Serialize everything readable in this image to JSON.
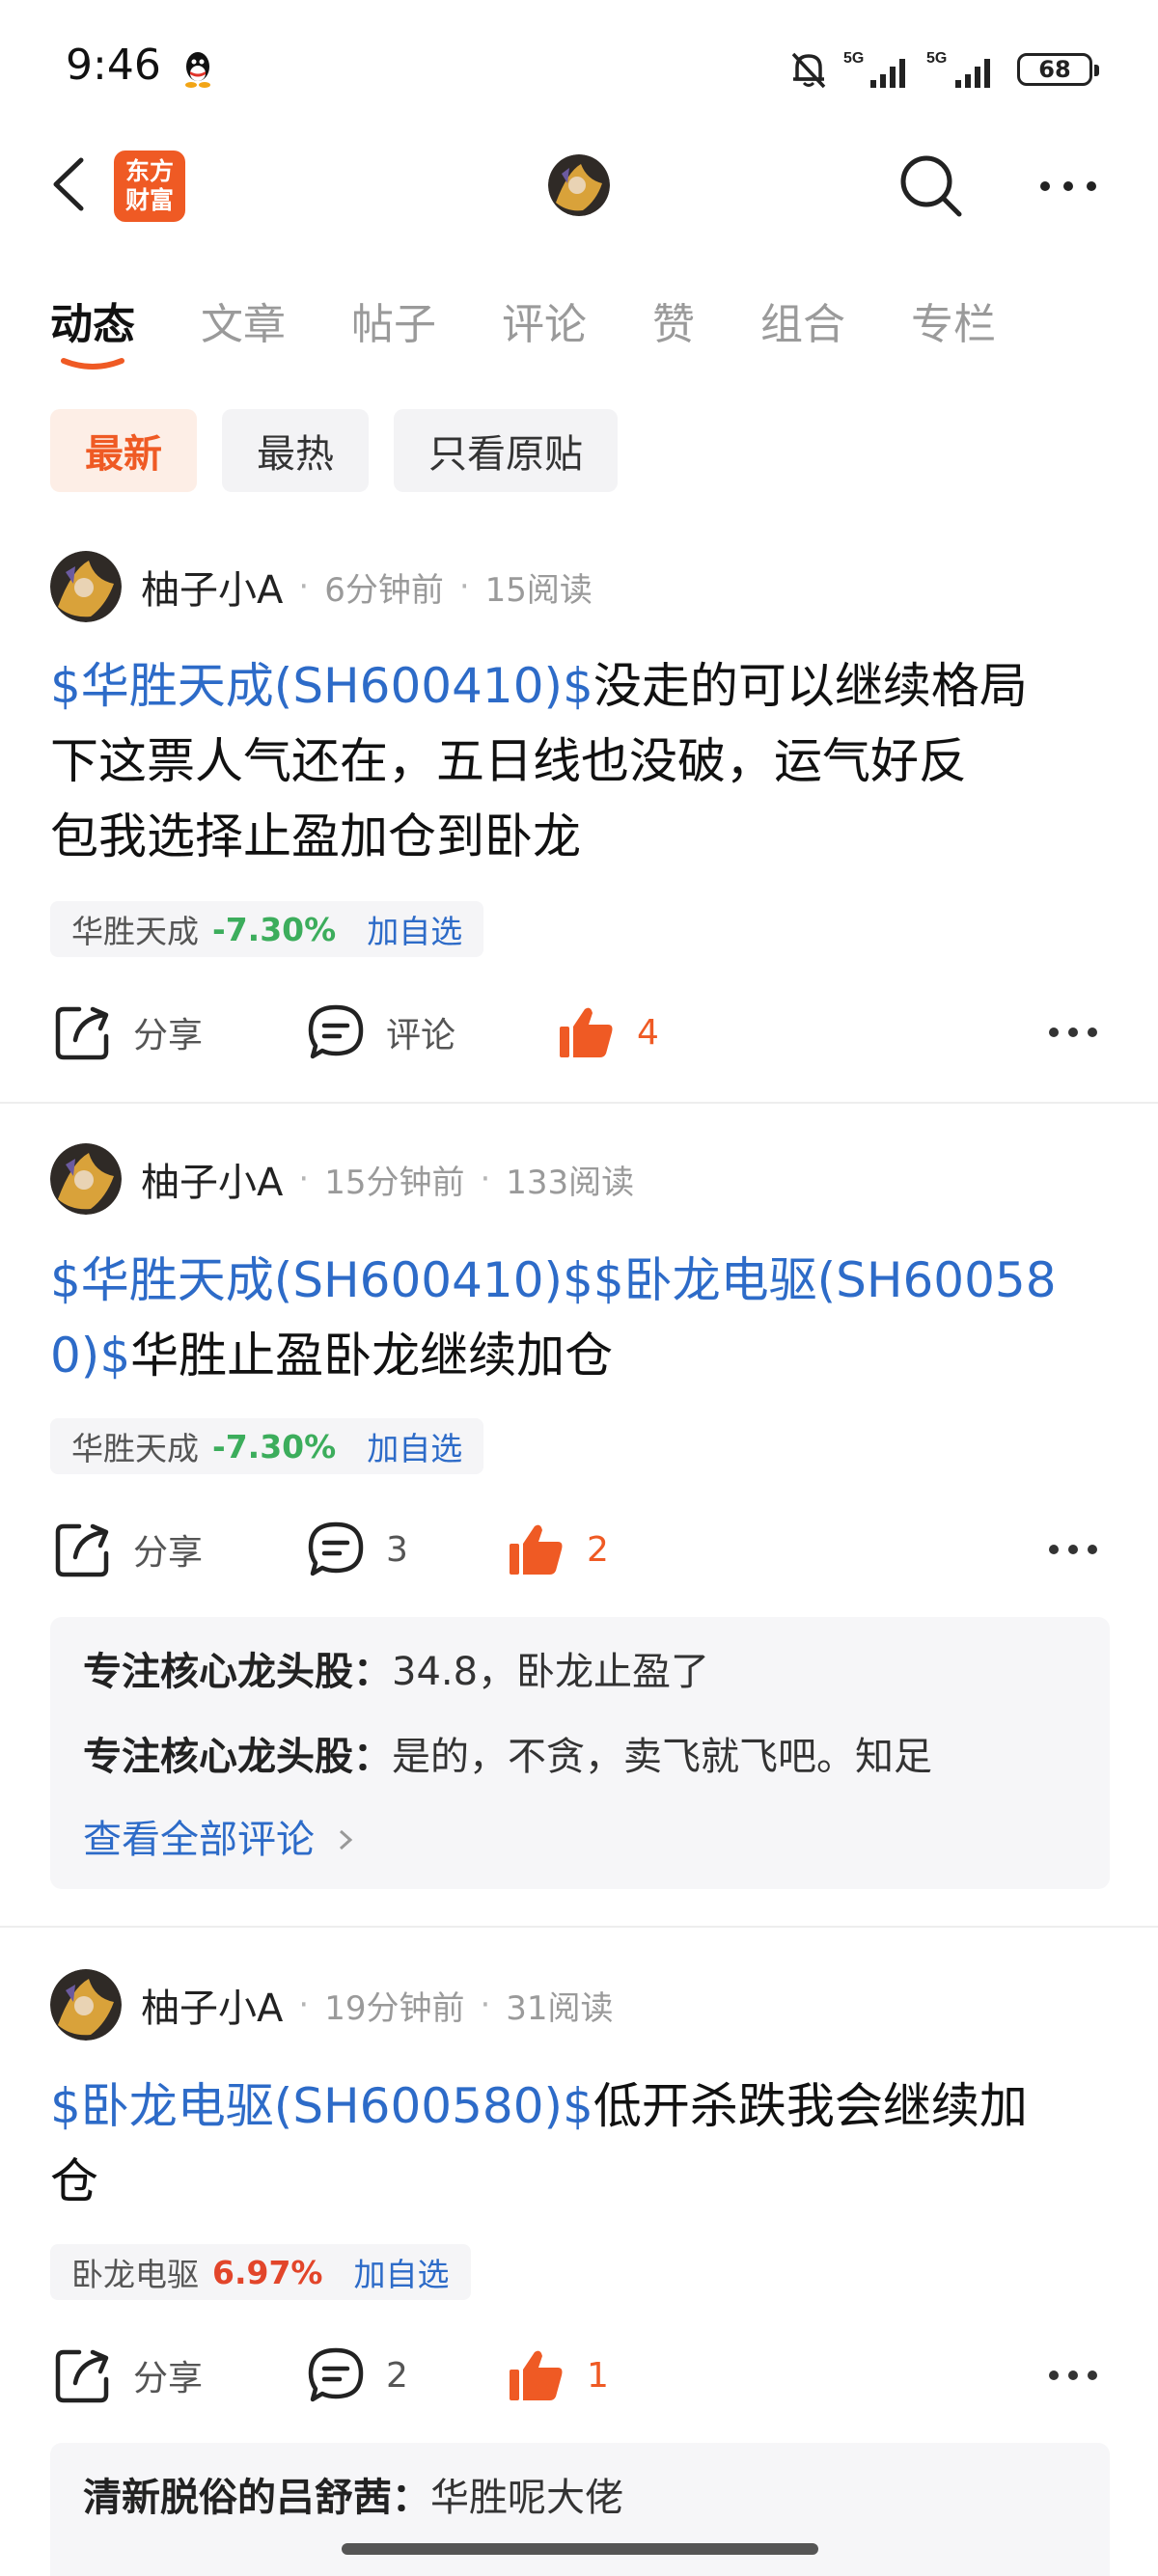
{
  "status_bar": {
    "time": "9:46",
    "battery": "68",
    "signal1": "5G",
    "signal2": "5G"
  },
  "header": {
    "logo_line1": "东方",
    "logo_line2": "财富"
  },
  "tabs": [
    {
      "label": "动态"
    },
    {
      "label": "文章"
    },
    {
      "label": "帖子"
    },
    {
      "label": "评论"
    },
    {
      "label": "赞"
    },
    {
      "label": "组合"
    },
    {
      "label": "专栏"
    }
  ],
  "filters": [
    {
      "label": "最新"
    },
    {
      "label": "最热"
    },
    {
      "label": "只看原贴"
    }
  ],
  "posts": [
    {
      "author": "柚子小A",
      "time": "6分钟前",
      "reads": "15阅读",
      "link1": "$华胜天成(SH600410)$",
      "text_line1": "没走的可以继续格局",
      "text_line2": "下这票人气还在，五日线也没破，运气好反",
      "text_line3": "包我选择止盈加仓到卧龙",
      "stock_name": "华胜天成",
      "stock_pct": "-7.30%",
      "add_watch": "加自选",
      "share": "分享",
      "comment": "评论",
      "likes": "4"
    },
    {
      "author": "柚子小A",
      "time": "15分钟前",
      "reads": "133阅读",
      "link1": "$华胜天成(SH600410)$$卧龙电驱(SH60058",
      "link2": "0)$",
      "text_line2": "华胜止盈卧龙继续加仓",
      "stock_name": "华胜天成",
      "stock_pct": "-7.30%",
      "add_watch": "加自选",
      "share": "分享",
      "comment": "3",
      "likes": "2",
      "comments": [
        {
          "author": "专注核心龙头股：",
          "text": "34.8，卧龙止盈了"
        },
        {
          "author": "专注核心龙头股：",
          "text": "是的，不贪，卖飞就飞吧。知足"
        }
      ],
      "see_all": "查看全部评论"
    },
    {
      "author": "柚子小A",
      "time": "19分钟前",
      "reads": "31阅读",
      "link1": "$卧龙电驱(SH600580)$",
      "text_line1": "低开杀跌我会继续加",
      "text_line2": "仓",
      "stock_name": "卧龙电驱",
      "stock_pct": "6.97%",
      "add_watch": "加自选",
      "share": "分享",
      "comment": "2",
      "likes": "1",
      "comments": [
        {
          "author": "清新脱俗的吕舒茜：",
          "text": "华胜呢大佬"
        }
      ]
    }
  ],
  "colors": {
    "accent": "#ef5a24",
    "link": "#2d6bc8",
    "down": "#3cad5c",
    "up": "#e2452a"
  }
}
